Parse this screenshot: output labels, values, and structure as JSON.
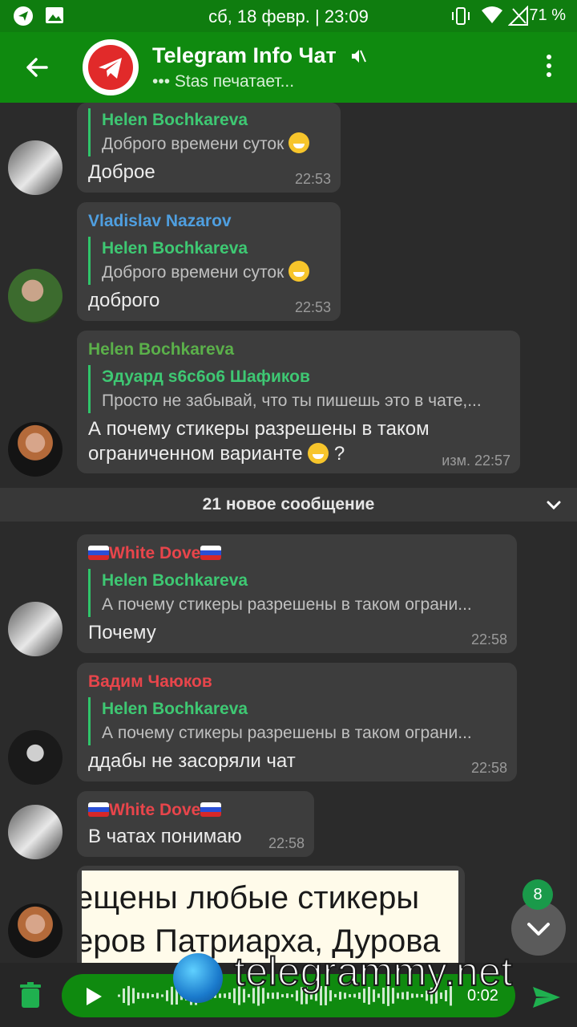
{
  "status_bar": {
    "datetime": "сб, 18 февр. | 23:09",
    "battery": "71 %"
  },
  "header": {
    "title": "Telegram Info Чат",
    "typing": "••• Stas печатает..."
  },
  "messages": [
    {
      "reply_name": "Helen Bochkareva",
      "reply_text": "Доброго времени суток",
      "text": "Доброе",
      "time": "22:53"
    },
    {
      "sender": "Vladislav Nazarov",
      "sender_color": "#4f9fe0",
      "reply_name": "Helen Bochkareva",
      "reply_text": "Доброго времени суток",
      "text": "доброго",
      "time": "22:53"
    },
    {
      "sender": "Helen Bochkareva",
      "sender_color": "#5bb04a",
      "reply_name": "Эдуард s6c6o6 Шафиков",
      "reply_text": "Просто не забывай, что ты пишешь это в чате,...",
      "text_line1": "А почему стикеры разрешены в таком",
      "text_line2": "ограниченном варианте",
      "text_suffix": " ?",
      "time": "изм. 22:57"
    },
    {
      "sender": "White Dove",
      "sender_color": "#e8454b",
      "reply_name": "Helen Bochkareva",
      "reply_text": "А почему стикеры разрешены в таком ограни...",
      "text": "Почему",
      "time": "22:58"
    },
    {
      "sender": "Вадим Чаюков",
      "sender_color": "#e8454b",
      "reply_name": "Helen Bochkareva",
      "reply_text": "А почему стикеры разрешены в таком ограни...",
      "text": "ддабы не засоряли чат",
      "time": "22:58"
    },
    {
      "sender": "White Dove",
      "sender_color": "#e8454b",
      "text": "В чатах понимаю",
      "time": "22:58"
    }
  ],
  "new_messages_divider": "21 новое сообщение",
  "sticker": {
    "line1": "ещены любые стикеры",
    "line2": "еров Патриарха, Дурова"
  },
  "scroll_badge": "8",
  "voice": {
    "duration": "0:02"
  },
  "watermark": "telegrammy.net",
  "colors": {
    "appbar": "#0f8a0f",
    "accent_green": "#3ec873",
    "bubble": "#3d3d3d"
  },
  "icons": [
    "telegram-location-icon",
    "gallery-icon",
    "vibrate-icon",
    "wifi-icon",
    "signal-icon",
    "back-arrow-icon",
    "mute-icon",
    "more-vert-icon",
    "chevron-down-icon",
    "trash-icon",
    "play-icon",
    "send-icon"
  ]
}
